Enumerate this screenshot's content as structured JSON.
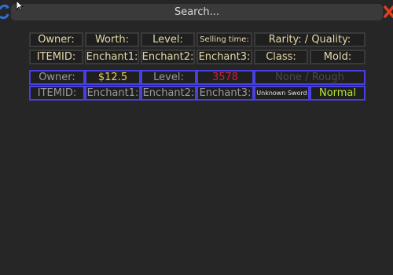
{
  "search": {
    "placeholder": "Search..."
  },
  "header": {
    "row1": [
      "Owner:",
      "Worth:",
      "Level:",
      "Selling time:",
      "Rarity: / Quality:"
    ],
    "row2": [
      "ITEMID:",
      "Enchant1:",
      "Enchant2:",
      "Enchant3:",
      "Class:",
      "Mold:"
    ]
  },
  "item": {
    "owner_label": "Owner:",
    "worth": "$12.5",
    "level_label": "Level:",
    "selling_time": "3578",
    "rarity_quality": "None / Rough",
    "itemid_label": "ITEMID:",
    "enchant1": "Enchant1:",
    "enchant2": "Enchant2:",
    "enchant3": "Enchant3:",
    "class": "Unknown Sword",
    "mold": "Normal"
  },
  "colors": {
    "header_text": "#e6d9a8",
    "item_border": "#4840e0",
    "worth": "#e8d050",
    "selling_time": "#d0203c",
    "rarity_quality": "#4a4a4a",
    "mold": "#b4e830"
  }
}
